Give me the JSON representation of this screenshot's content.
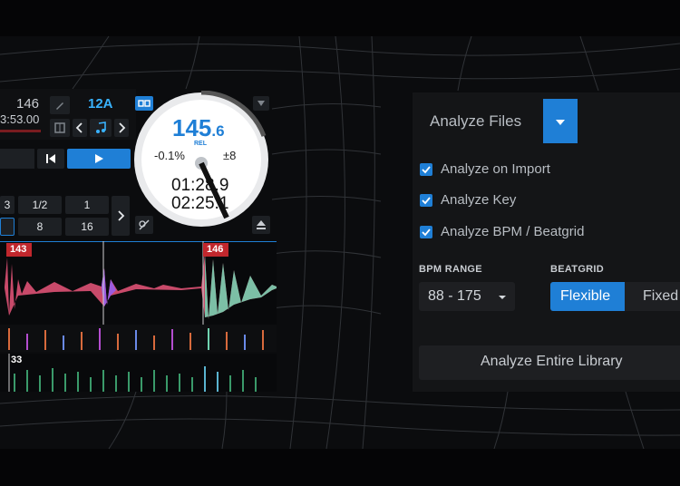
{
  "deck": {
    "bpm_small": "146",
    "time_small": "3:53.00",
    "key": "12A",
    "tempo_main": "145",
    "tempo_dec": ".6",
    "tempo_mode": "REL",
    "pitch_pct": "-0.1%",
    "pitch_range": "±8",
    "elapsed": "01:28.9",
    "remaining": "02:25.1",
    "loop_sizes_row1": [
      "3",
      "1/2",
      "1"
    ],
    "loop_sizes_row2": [
      "",
      "8",
      "16"
    ],
    "cue_labels": [
      "143",
      "146"
    ],
    "overview_bpm": "33",
    "colors": {
      "accent": "#1f7fd6",
      "cue_red": "#c1272d"
    }
  },
  "analyze": {
    "title": "Analyze Files",
    "options": [
      {
        "label": "Analyze on Import",
        "checked": true
      },
      {
        "label": "Analyze Key",
        "checked": true
      },
      {
        "label": "Analyze BPM / Beatgrid",
        "checked": true
      }
    ],
    "bpm_range_caption": "BPM RANGE",
    "bpm_range_value": "88 - 175",
    "beatgrid_caption": "BEATGRID",
    "beatgrid_options": [
      "Flexible",
      "Fixed"
    ],
    "beatgrid_selected": "Flexible",
    "analyze_library_label": "Analyze Entire Library"
  }
}
